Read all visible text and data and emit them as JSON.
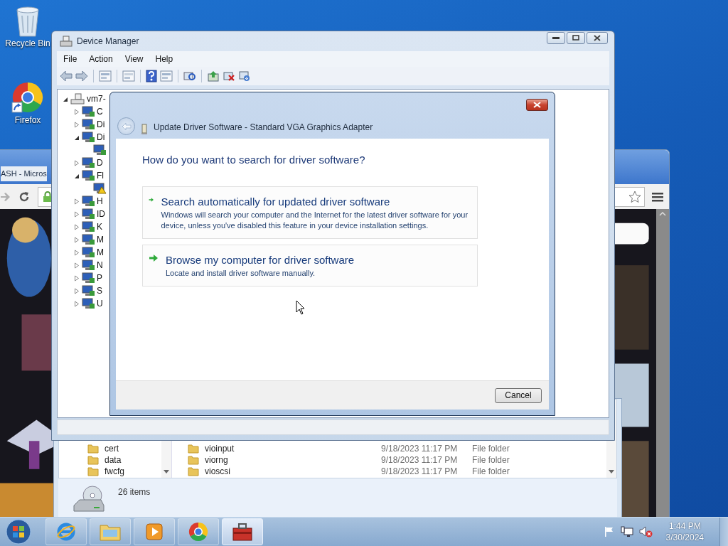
{
  "desktop_icons": [
    {
      "label": "Recycle Bin",
      "kind": "recycle"
    },
    {
      "label": "Firefox",
      "kind": "chrome"
    }
  ],
  "browser": {
    "title": "ASH - Micros"
  },
  "explorer": {
    "nav_items": [
      "cert",
      "data",
      "fwcfg"
    ],
    "files": [
      {
        "name": "vioinput",
        "date": "9/18/2023 11:17 PM",
        "type": "File folder"
      },
      {
        "name": "viorng",
        "date": "9/18/2023 11:17 PM",
        "type": "File folder"
      },
      {
        "name": "vioscsi",
        "date": "9/18/2023 11:17 PM",
        "type": "File folder"
      }
    ],
    "status": "26 items"
  },
  "device_manager": {
    "title": "Device Manager",
    "menu": [
      "File",
      "Action",
      "View",
      "Help"
    ],
    "tree": {
      "label": "vm7-",
      "expanded": true,
      "children": [
        {
          "label": "C",
          "expanded": false
        },
        {
          "label": "Di",
          "expanded": false
        },
        {
          "label": "Di",
          "expanded": true,
          "children": [
            {
              "warning": false
            }
          ]
        },
        {
          "label": "D",
          "expanded": false
        },
        {
          "label": "Fl",
          "expanded": true,
          "children": [
            {
              "warning": true
            }
          ]
        },
        {
          "label": "H",
          "expanded": false
        },
        {
          "label": "ID",
          "expanded": false
        },
        {
          "label": "K",
          "expanded": false
        },
        {
          "label": "M",
          "expanded": false
        },
        {
          "label": "M",
          "expanded": false
        },
        {
          "label": "N",
          "expanded": false
        },
        {
          "label": "P",
          "expanded": false
        },
        {
          "label": "S",
          "expanded": false
        },
        {
          "label": "U",
          "expanded": false
        }
      ]
    }
  },
  "dialog": {
    "title": "Update Driver Software - Standard VGA Graphics Adapter",
    "back_disabled": true,
    "heading": "How do you want to search for driver software?",
    "options": [
      {
        "title": "Search automatically for updated driver software",
        "description": "Windows will search your computer and the Internet for the latest driver software for your device, unless you've disabled this feature in your device installation settings."
      },
      {
        "title": "Browse my computer for driver software",
        "description": "Locate and install driver software manually."
      }
    ],
    "buttons": [
      "Cancel"
    ]
  },
  "taskbar": {
    "apps": [
      {
        "kind": "ie",
        "selected": false
      },
      {
        "kind": "explorer",
        "selected": false
      },
      {
        "kind": "media",
        "selected": false
      },
      {
        "kind": "chrome",
        "selected": false
      },
      {
        "kind": "devmgr",
        "selected": true
      }
    ],
    "time": "1:44 PM",
    "date": "3/30/2024"
  }
}
